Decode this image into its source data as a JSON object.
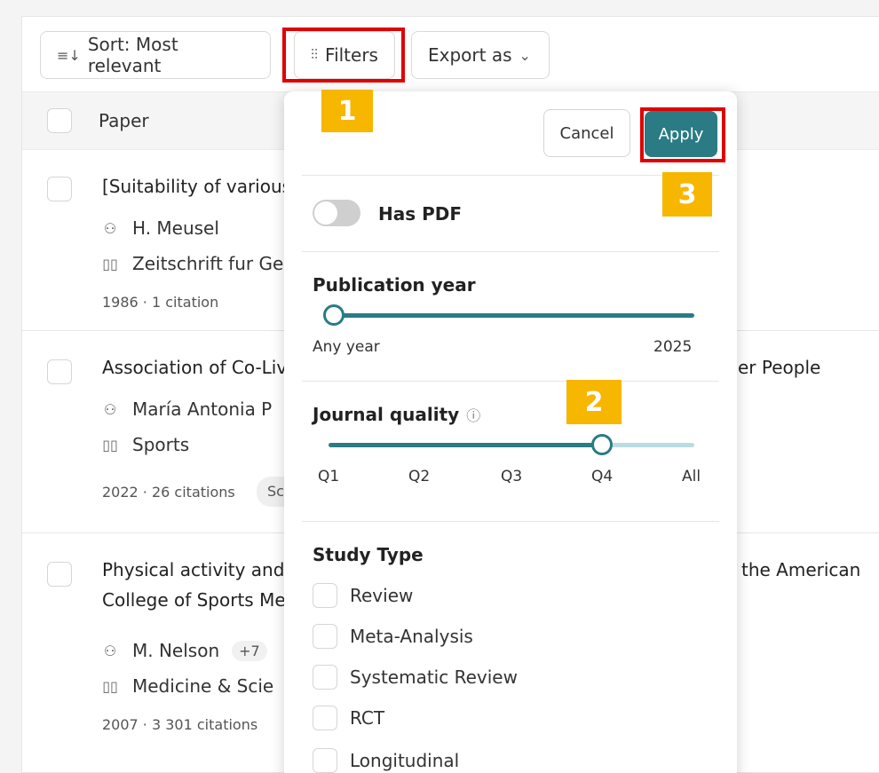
{
  "toolbar": {
    "sort_icon": "sort-icon",
    "sort_label": "Sort: Most relevant",
    "filters_icon": "sliders-icon",
    "filters_label": "Filters",
    "export_label": "Export as",
    "export_icon": "chevron-down-icon"
  },
  "table": {
    "header": "Paper",
    "rows": [
      {
        "title": "[Suitability of various",
        "title_right": "",
        "authors": "H. Meusel",
        "journal": "Zeitschrift fur Ge",
        "footer": "1986 · 1 citation"
      },
      {
        "title": "Association of Co-Liv",
        "title_right": "er People",
        "authors": "María Antonia P",
        "journal": "Sports",
        "footer": "2022 · 26 citations",
        "chip": "Sc"
      },
      {
        "title": "Physical activity and",
        "title2": "College of Sports Me",
        "title_right": "the American",
        "authors": "M. Nelson",
        "authors_more": "+7",
        "journal": "Medicine & Scie",
        "footer": "2007 · 3 301 citations"
      }
    ]
  },
  "filters": {
    "cancel_label": "Cancel",
    "apply_label": "Apply",
    "has_pdf_label": "Has PDF",
    "has_pdf_on": false,
    "pub_year": {
      "label": "Publication year",
      "min_label": "Any year",
      "max_label": "2025",
      "value_fraction": 0.0
    },
    "journal_quality": {
      "label": "Journal quality",
      "info_icon": "info-icon",
      "ticks": [
        "Q1",
        "Q2",
        "Q3",
        "Q4",
        "All"
      ],
      "selected": "Q4"
    },
    "study_type": {
      "label": "Study Type",
      "options": [
        "Review",
        "Meta-Analysis",
        "Systematic Review",
        "RCT",
        "Longitudinal"
      ]
    }
  },
  "annotations": [
    "1",
    "2",
    "3"
  ],
  "colors": {
    "accent": "#2a7b84",
    "highlight": "#e00000",
    "badge": "#f7b600"
  }
}
